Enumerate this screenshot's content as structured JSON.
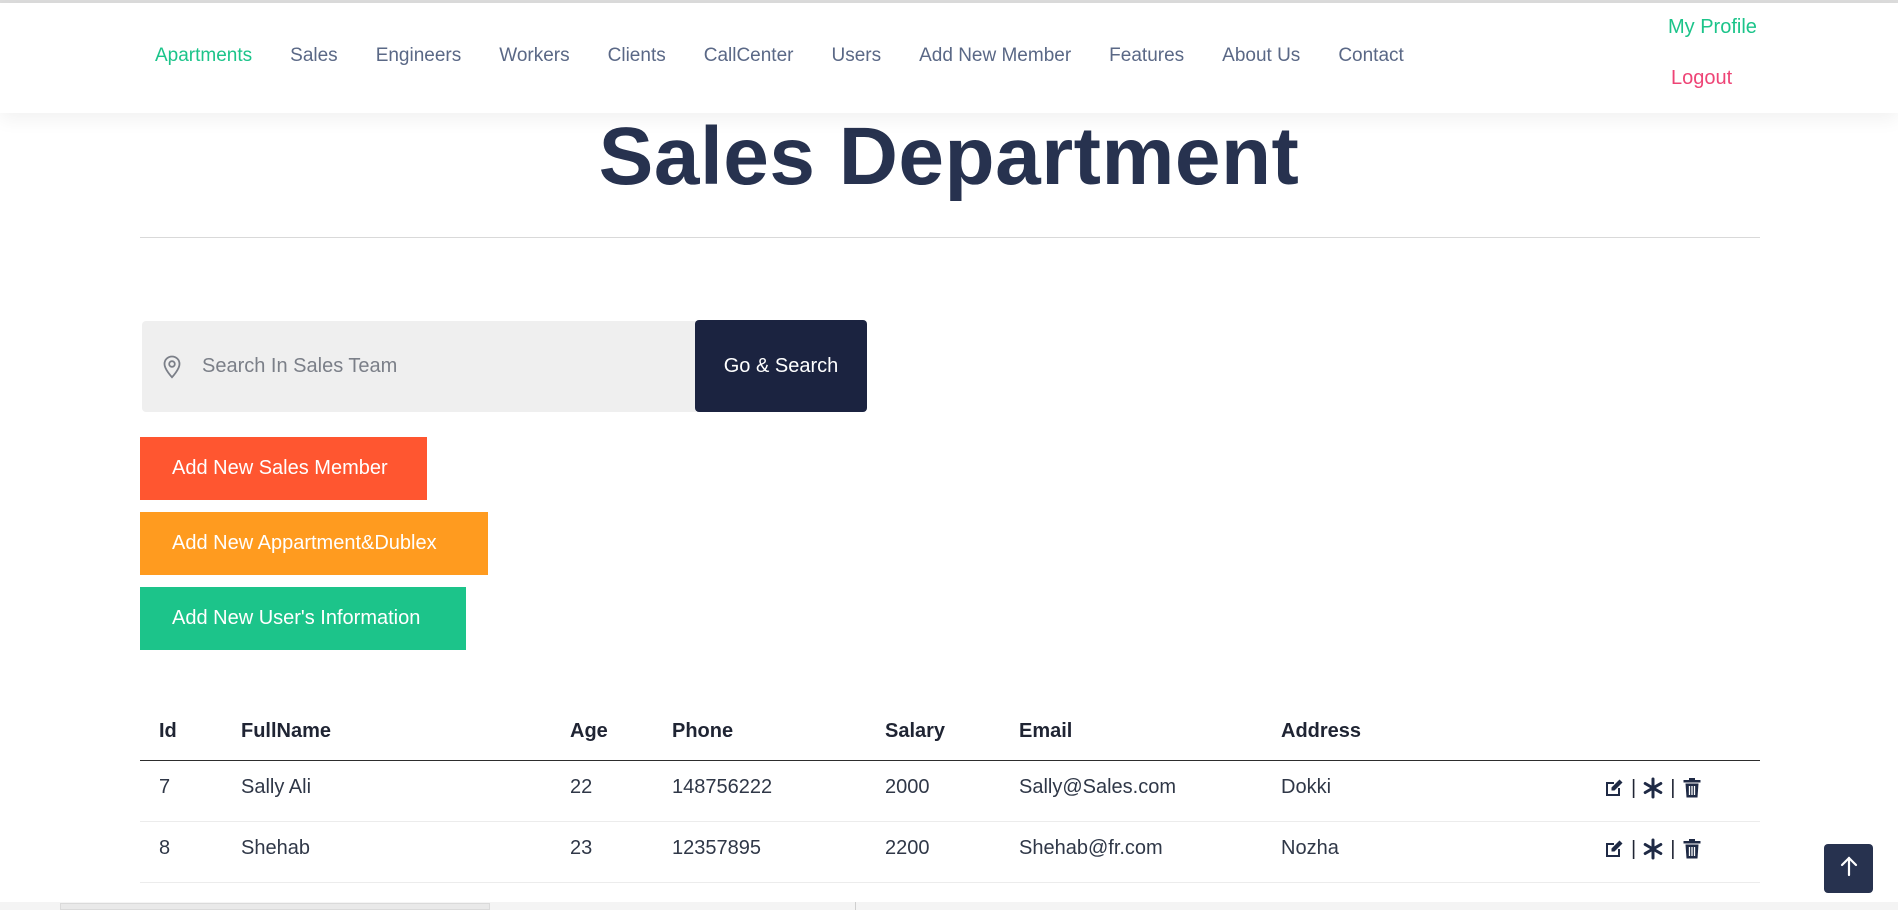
{
  "nav": {
    "items": [
      {
        "label": "Apartments",
        "active": true
      },
      {
        "label": "Sales"
      },
      {
        "label": "Engineers"
      },
      {
        "label": "Workers"
      },
      {
        "label": "Clients"
      },
      {
        "label": "CallCenter"
      },
      {
        "label": "Users"
      },
      {
        "label": "Add New Member"
      },
      {
        "label": "Features"
      },
      {
        "label": "About Us"
      },
      {
        "label": "Contact"
      }
    ],
    "profile": "My Profile",
    "logout": "Logout"
  },
  "page_title": "Sales Department",
  "search": {
    "placeholder": "Search In Sales Team",
    "button": "Go & Search"
  },
  "actions": {
    "add_sales_member": "Add New Sales Member",
    "add_apartment": "Add New Appartment&Dublex",
    "add_user_info": "Add New User's Information"
  },
  "table": {
    "headers": {
      "id": "Id",
      "fullname": "FullName",
      "age": "Age",
      "phone": "Phone",
      "salary": "Salary",
      "email": "Email",
      "address": "Address"
    },
    "rows": [
      {
        "id": "7",
        "fullname": "Sally Ali",
        "age": "22",
        "phone": "148756222",
        "salary": "2000",
        "email": "Sally@Sales.com",
        "address": "Dokki"
      },
      {
        "id": "8",
        "fullname": "Shehab",
        "age": "23",
        "phone": "12357895",
        "salary": "2200",
        "email": "Shehab@fr.com",
        "address": "Nozha"
      }
    ],
    "row_actions": {
      "separator": "|"
    }
  },
  "colors": {
    "accent_green": "#1cc48a",
    "logout_pink": "#ee4476",
    "title_navy": "#27324f",
    "search_btn": "#1b2340",
    "btn_red": "#ff5630",
    "btn_orange": "#ff9b1f"
  },
  "icons": {
    "search_field": "map-pin-icon",
    "row_actions": [
      "edit-icon",
      "asterisk-icon",
      "trash-icon"
    ],
    "scroll_top": "arrow-up-icon"
  }
}
